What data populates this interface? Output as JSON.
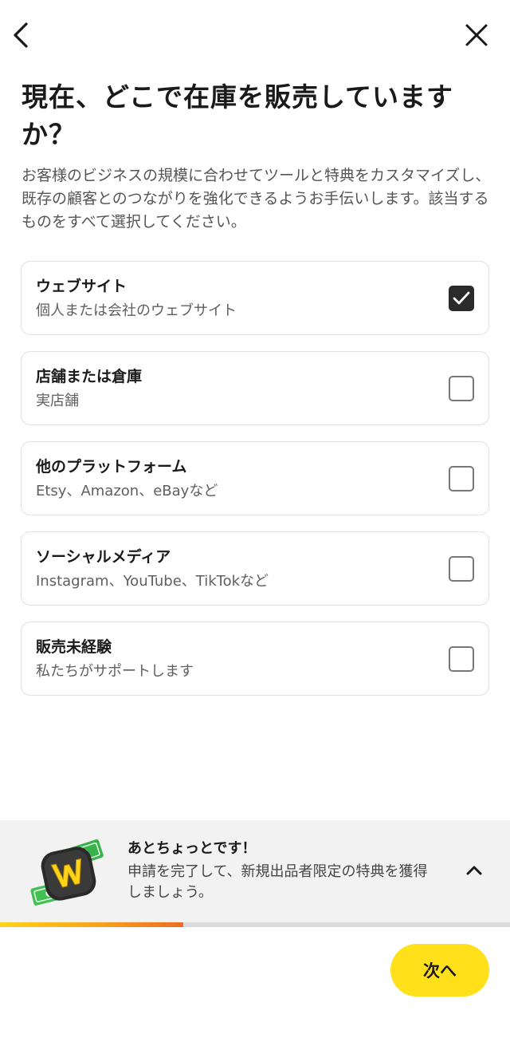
{
  "header": {
    "back_icon": "chevron-left-icon",
    "close_icon": "close-icon"
  },
  "title": "現在、どこで在庫を販売していますか？",
  "subtitle": "お客様のビジネスの規模に合わせてツールと特典をカスタマイズし、既存の顧客とのつながりを強化できるようお手伝いします。該当するものをすべて選択してください。",
  "options": [
    {
      "label": "ウェブサイト",
      "description": "個人または会社のウェブサイト",
      "checked": true
    },
    {
      "label": "店舗または倉庫",
      "description": "実店舗",
      "checked": false
    },
    {
      "label": "他のプラットフォーム",
      "description": "Etsy、Amazon、eBayなど",
      "checked": false
    },
    {
      "label": "ソーシャルメディア",
      "description": "Instagram、YouTube、TikTokなど",
      "checked": false
    },
    {
      "label": "販売未経験",
      "description": "私たちがサポートします",
      "checked": false
    }
  ],
  "promo": {
    "title": "あとちょっとです！",
    "text": "申請を完了して、新規出品者限定の特典を獲得しましょう。",
    "icon": "money-w-icon",
    "collapse_icon": "chevron-up-icon"
  },
  "progress": {
    "fraction": 0.36
  },
  "colors": {
    "accent": "#ffe01b",
    "checked": "#2b2b2b"
  },
  "footer": {
    "next_label": "次へ"
  }
}
